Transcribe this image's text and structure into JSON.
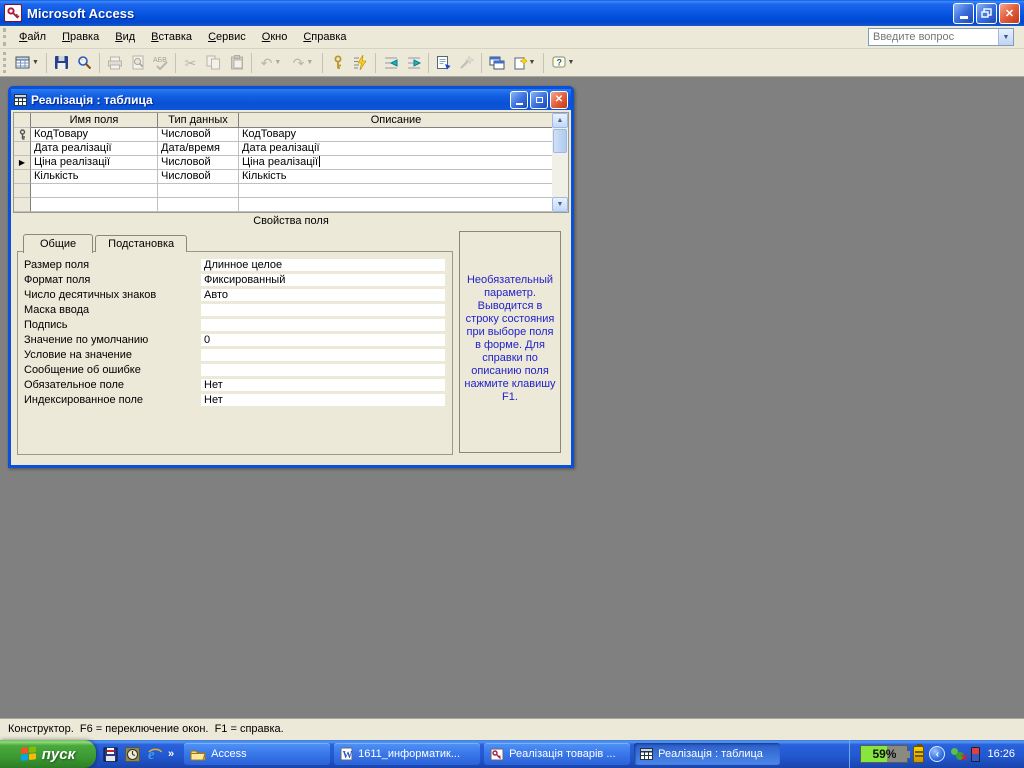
{
  "window": {
    "title": "Microsoft Access"
  },
  "menu": {
    "items": [
      "Файл",
      "Правка",
      "Вид",
      "Вставка",
      "Сервис",
      "Окно",
      "Справка"
    ],
    "question_placeholder": "Введите вопрос"
  },
  "toolbar": {
    "icons": [
      "view-design",
      "save",
      "file-search",
      "print",
      "print-preview",
      "spelling",
      "cut",
      "copy",
      "paste",
      "undo",
      "redo",
      "primary-key",
      "indexes",
      "insert-rows",
      "delete-rows",
      "properties",
      "build",
      "database-window",
      "new-object",
      "help"
    ]
  },
  "doc": {
    "title": "Реалізація : таблица",
    "grid": {
      "headers": [
        "Имя поля",
        "Тип данных",
        "Описание"
      ],
      "rows": [
        {
          "selector": "primary-key",
          "name": "КодТовару",
          "type": "Числовой",
          "desc": "КодТовару"
        },
        {
          "selector": "",
          "name": "Дата реалізації",
          "type": "Дата/время",
          "desc": "Дата реалізації"
        },
        {
          "selector": "current-row-arrow",
          "name": "Ціна реалізації",
          "type": "Числовой",
          "desc": "Ціна реалізації"
        },
        {
          "selector": "",
          "name": "Кількість",
          "type": "Числовой",
          "desc": "Кількість"
        },
        {
          "selector": "",
          "name": "",
          "type": "",
          "desc": ""
        },
        {
          "selector": "",
          "name": "",
          "type": "",
          "desc": ""
        }
      ]
    },
    "properties_caption": "Свойства поля",
    "tabs": [
      "Общие",
      "Подстановка"
    ],
    "props": [
      {
        "label": "Размер поля",
        "value": "Длинное целое"
      },
      {
        "label": "Формат поля",
        "value": "Фиксированный"
      },
      {
        "label": "Число десятичных знаков",
        "value": "Авто"
      },
      {
        "label": "Маска ввода",
        "value": ""
      },
      {
        "label": "Подпись",
        "value": ""
      },
      {
        "label": "Значение по умолчанию",
        "value": "0"
      },
      {
        "label": "Условие на значение",
        "value": ""
      },
      {
        "label": "Сообщение об ошибке",
        "value": ""
      },
      {
        "label": "Обязательное поле",
        "value": "Нет"
      },
      {
        "label": "Индексированное поле",
        "value": "Нет"
      }
    ],
    "help_text": "Необязательный параметр. Выводится в строку состояния при выборе поля в форме.  Для справки по описанию поля нажмите клавишу F1."
  },
  "status": {
    "text": "Конструктор.  F6 = переключение окон.  F1 = справка."
  },
  "taskbar": {
    "start_label": "пуск",
    "buttons": [
      {
        "label": "Access",
        "icon": "folder"
      },
      {
        "label": "1611_информатик...",
        "icon": "word-document"
      },
      {
        "label": "Реалізація товарів ...",
        "icon": "access-database"
      },
      {
        "label": "Реалізація : таблица",
        "icon": "table",
        "active": true
      }
    ],
    "tray": {
      "battery_percent": "59%",
      "time": "16:26"
    }
  },
  "colors": {
    "titlebar_blue": "#0b51d8",
    "taskbar_blue": "#2157cf",
    "start_green": "#3c9a33",
    "help_text_blue": "#2222cc",
    "battery_green": "#86e63e",
    "workspace_gray": "#808080",
    "chrome_beige": "#ece9d8"
  }
}
